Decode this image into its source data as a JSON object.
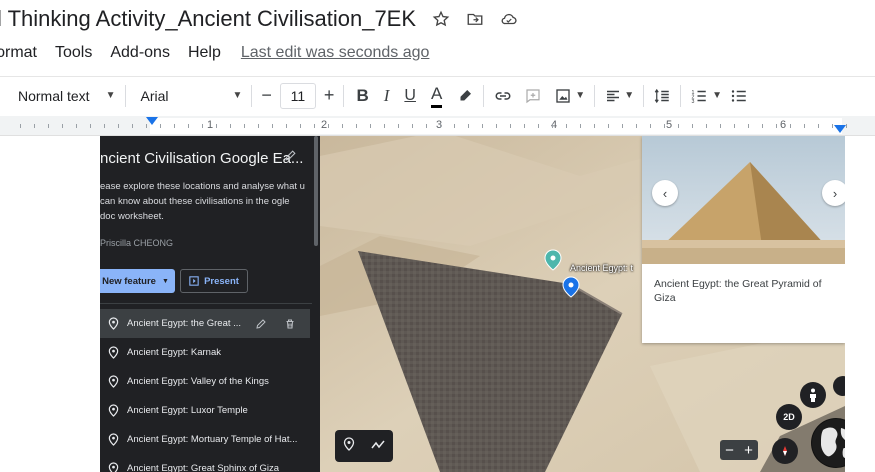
{
  "app": {
    "doc_title": "l Thinking Activity_Ancient Civilisation_7EK",
    "star_icon": "star-icon",
    "move_icon": "move-to-folder-icon",
    "cloud_icon": "cloud-saved-icon"
  },
  "menu": {
    "items": [
      "ɔrmat",
      "Tools",
      "Add-ons",
      "Help"
    ],
    "last_edit": "Last edit was seconds ago"
  },
  "toolbar": {
    "style": "Normal text",
    "font": "Arial",
    "font_size": "11",
    "minus": "−",
    "plus": "+",
    "bold": "B",
    "italic": "I",
    "underline": "U",
    "text_color": "A"
  },
  "ruler": {
    "numbers": [
      "1",
      "2",
      "3",
      "4",
      "5",
      "6"
    ]
  },
  "earth": {
    "project_title": "ncient Civilisation Google Ea...",
    "description": "ease explore these locations and analyse what u can know about these civilisations in the ogle doc worksheet.",
    "author": "Priscilla CHEONG",
    "new_feature_label": "New feature",
    "present_label": "Present",
    "features": [
      "Ancient Egypt: the Great ...",
      "Ancient Egypt: Karnak",
      "Ancient Egypt: Valley of the Kings",
      "Ancient Egypt: Luxor Temple",
      "Ancient Egypt: Mortuary Temple of Hat...",
      "Ancient Egypt: Great Sphinx of Giza"
    ],
    "pin_label": "Ancient Egypt: t",
    "card_title": "Ancient Egypt: the Great Pyramid of Giza",
    "card_prev": "‹",
    "card_next": "›",
    "view_2d": "2D",
    "zoom_out": "−",
    "zoom_in": "+"
  },
  "colors": {
    "accent": "#1a73e8",
    "panel_bg": "#202124",
    "button_blue": "#8ab4f8",
    "sand": "#d9c8ad"
  }
}
